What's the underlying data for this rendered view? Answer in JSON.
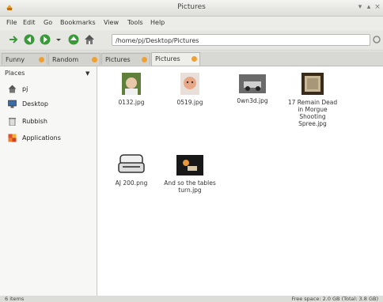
{
  "window": {
    "title": "Pictures"
  },
  "menu": [
    "File",
    "Edit",
    "Go",
    "Bookmarks",
    "View",
    "Tools",
    "Help"
  ],
  "location": {
    "path": "/home/pj/Desktop/Pictures"
  },
  "tabs": [
    {
      "label": "Funny"
    },
    {
      "label": "Random"
    },
    {
      "label": "Pictures"
    },
    {
      "label": "Pictures"
    }
  ],
  "sidebar": {
    "header": "Places",
    "items": [
      {
        "label": "pj",
        "icon": "home-icon"
      },
      {
        "label": "Desktop",
        "icon": "desktop-icon"
      },
      {
        "label": "Rubbish",
        "icon": "trash-icon"
      },
      {
        "label": "Applications",
        "icon": "applications-icon"
      }
    ]
  },
  "files": [
    {
      "name": "0132.jpg"
    },
    {
      "name": "0519.jpg"
    },
    {
      "name": "0wn3d.jpg"
    },
    {
      "name": "17 Remain Dead in Morgue Shooting Spree.jpg"
    },
    {
      "name": "AJ 200.png"
    },
    {
      "name": "And so the tables turn.jpg"
    }
  ],
  "status": {
    "items": "6 items",
    "free_space": "Free space: 2.0 GB (Total: 3.8 GB)"
  },
  "colors": {
    "accent_green": "#3a9a3a",
    "tab_close": "#f0a030"
  }
}
